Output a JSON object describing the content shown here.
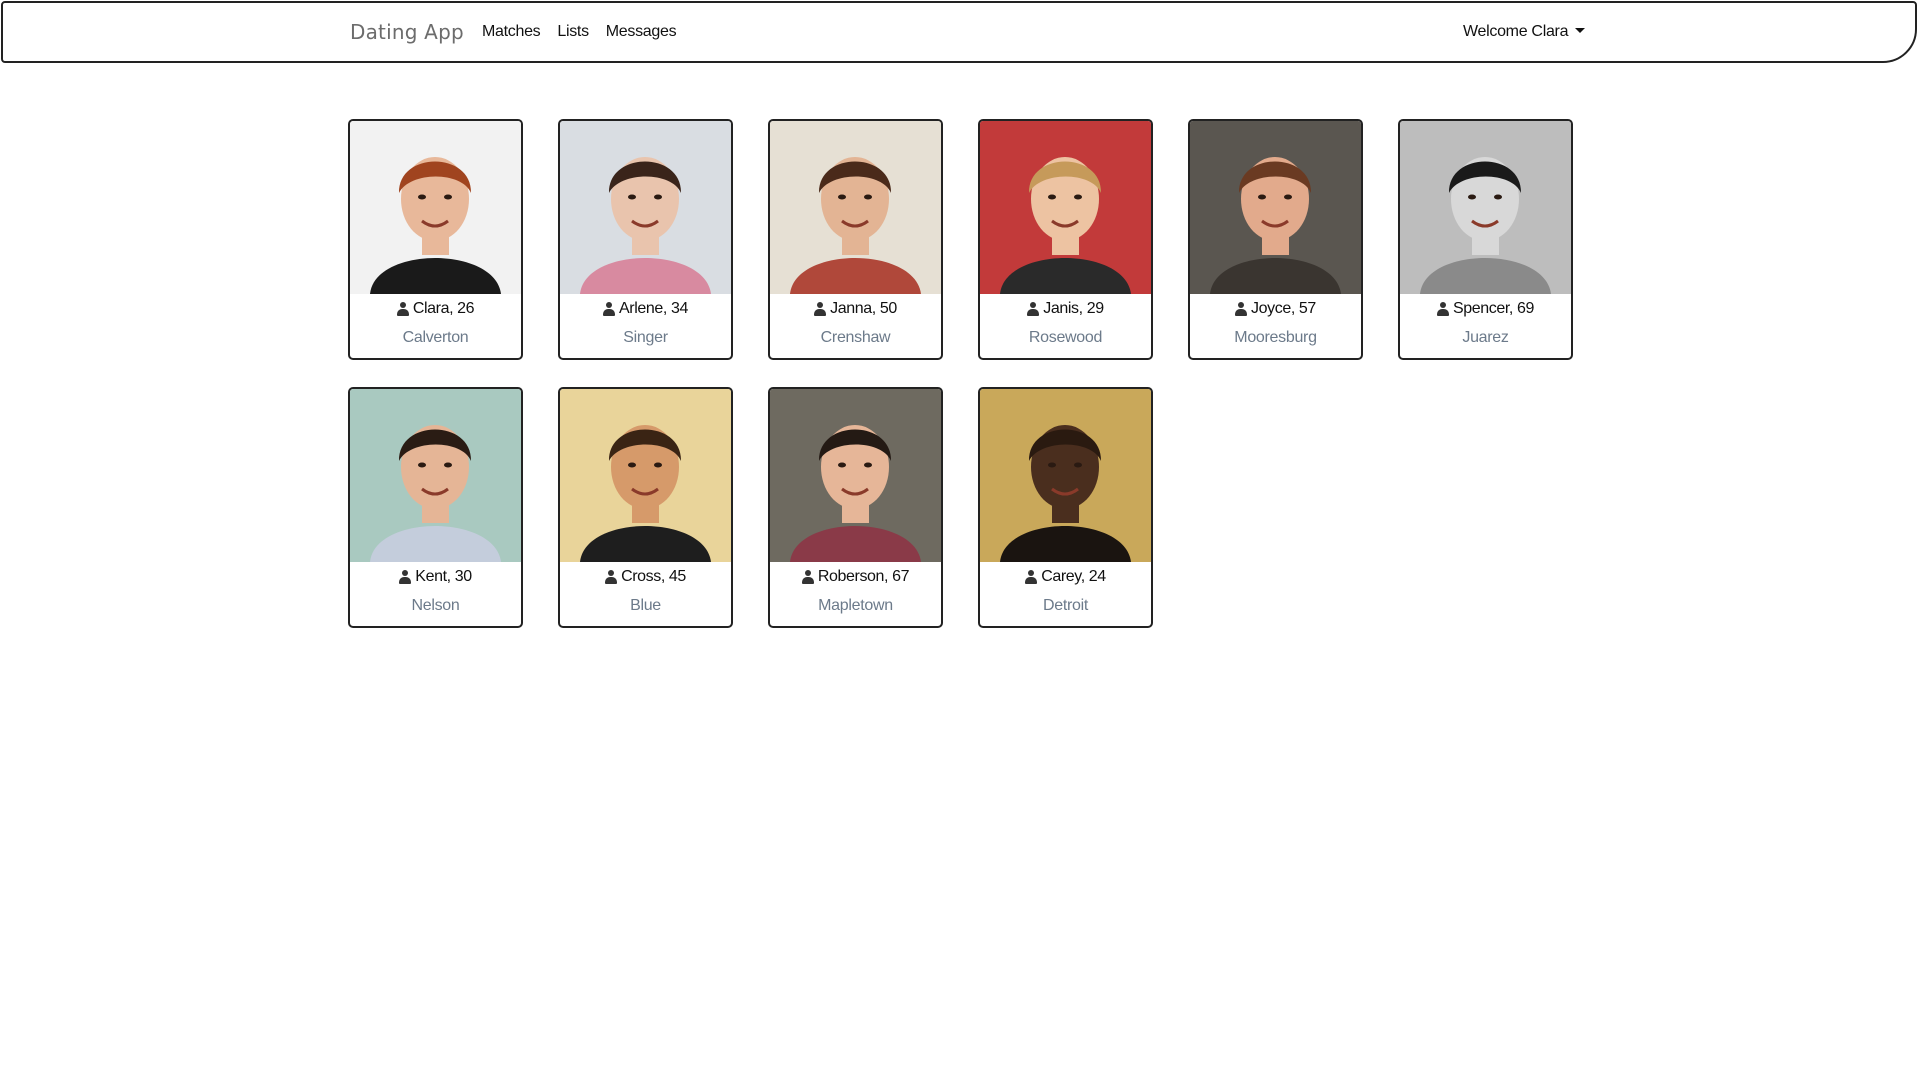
{
  "navbar": {
    "brand": "Dating App",
    "links": [
      "Matches",
      "Lists",
      "Messages"
    ],
    "welcome": "Welcome Clara"
  },
  "members": [
    {
      "name_age": "Clara, 26",
      "city": "Calverton",
      "photo": {
        "bg": "#f2f2f2",
        "skin": "#e8b89a",
        "hair": "#a0441f",
        "shirt": "#1a1a1a"
      }
    },
    {
      "name_age": "Arlene, 34",
      "city": "Singer",
      "photo": {
        "bg": "#d9dde2",
        "skin": "#e9c4ad",
        "hair": "#3a241a",
        "shirt": "#d88aa0"
      }
    },
    {
      "name_age": "Janna, 50",
      "city": "Crenshaw",
      "photo": {
        "bg": "#e6e0d4",
        "skin": "#e3b494",
        "hair": "#4a2a1a",
        "shirt": "#b0483a"
      }
    },
    {
      "name_age": "Janis, 29",
      "city": "Rosewood",
      "photo": {
        "bg": "#c23a3a",
        "skin": "#edc3a2",
        "hair": "#c69a5a",
        "shirt": "#2a2a2a"
      }
    },
    {
      "name_age": "Joyce, 57",
      "city": "Mooresburg",
      "photo": {
        "bg": "#5a5650",
        "skin": "#e2aa8c",
        "hair": "#6a3a22",
        "shirt": "#3a3530"
      }
    },
    {
      "name_age": "Spencer, 69",
      "city": "Juarez",
      "photo": {
        "bg": "#bdbdbd",
        "skin": "#d8d8d8",
        "hair": "#1a1a1a",
        "shirt": "#8a8a8a"
      }
    },
    {
      "name_age": "Kent, 30",
      "city": "Nelson",
      "photo": {
        "bg": "#a9c9c0",
        "skin": "#e5b596",
        "hair": "#2a1c14",
        "shirt": "#c4cddc"
      }
    },
    {
      "name_age": "Cross, 45",
      "city": "Blue",
      "photo": {
        "bg": "#e9d49a",
        "skin": "#d69a6a",
        "hair": "#3a2414",
        "shirt": "#1e1e1e"
      }
    },
    {
      "name_age": "Roberson, 67",
      "city": "Mapletown",
      "photo": {
        "bg": "#6e6a60",
        "skin": "#e6b698",
        "hair": "#241a14",
        "shirt": "#8a3a48"
      }
    },
    {
      "name_age": "Carey, 24",
      "city": "Detroit",
      "photo": {
        "bg": "#c9a85a",
        "skin": "#4a2e1e",
        "hair": "#2a1a10",
        "shirt": "#1a1410"
      }
    }
  ]
}
